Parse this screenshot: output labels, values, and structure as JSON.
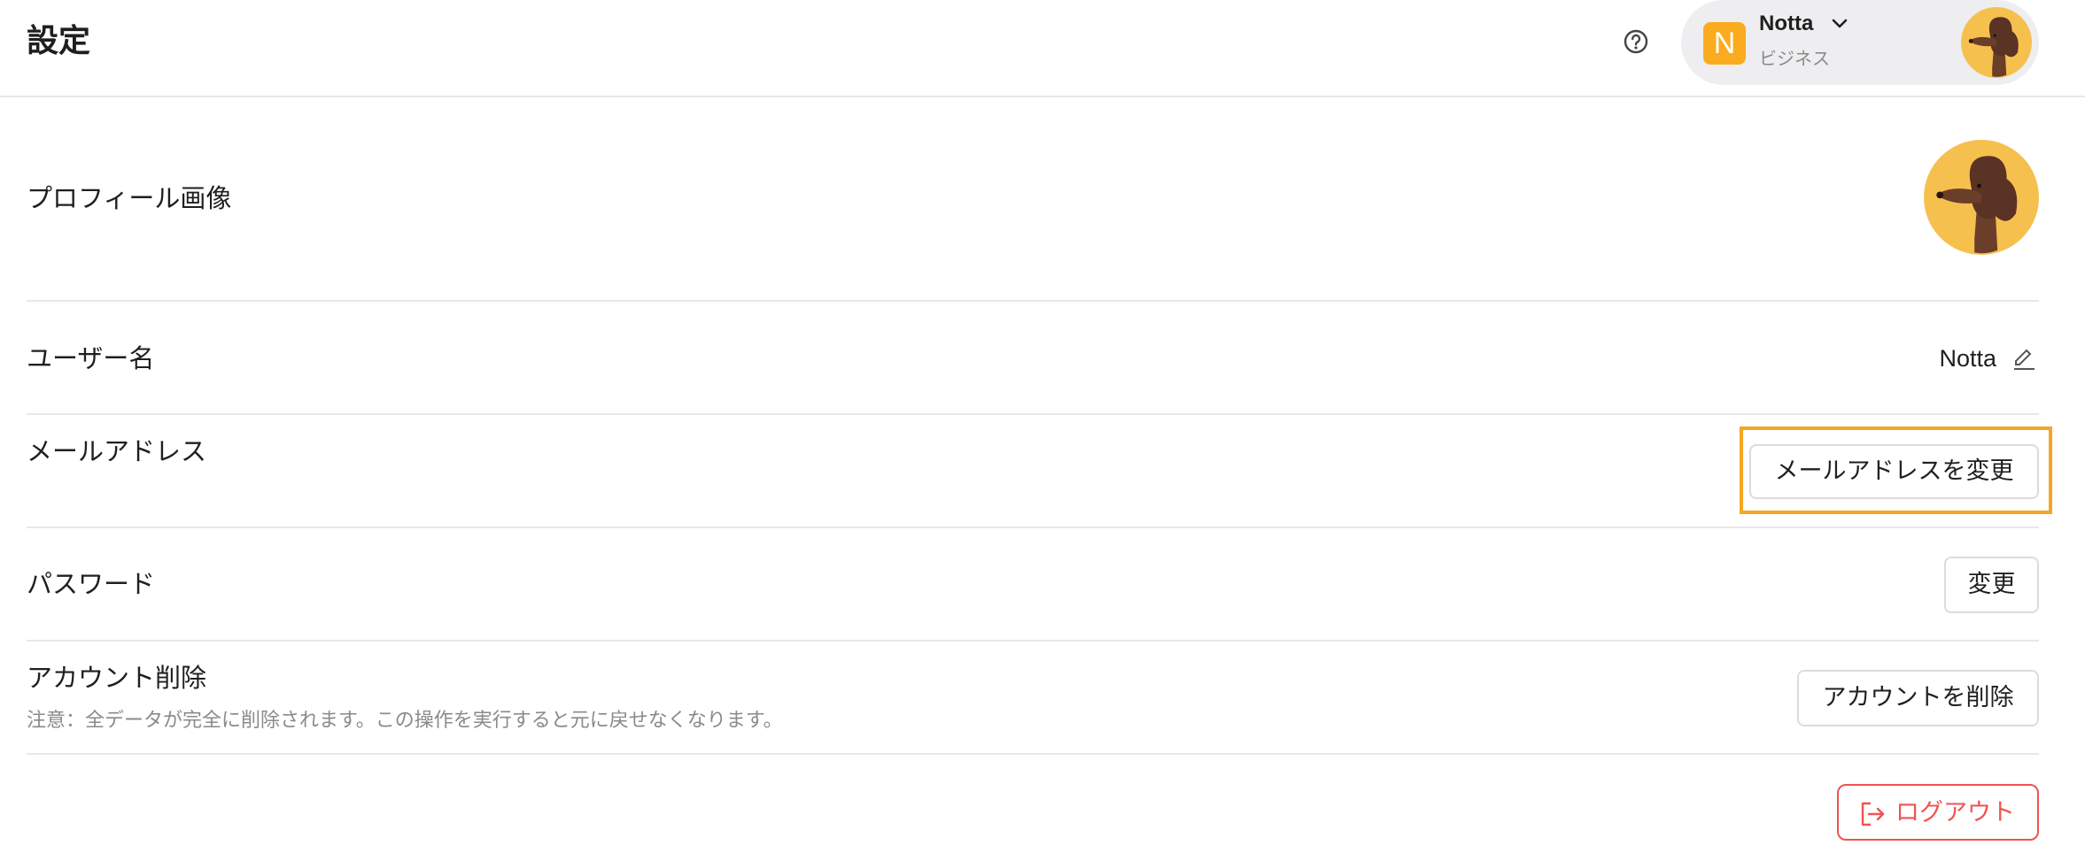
{
  "header": {
    "title": "設定",
    "help_icon": "help-circle-icon",
    "account": {
      "workspace_initial": "N",
      "workspace_name": "Notta",
      "plan": "ビジネス",
      "avatar_icon": "poodle-avatar-icon",
      "dropdown_icon": "chevron-down-icon"
    }
  },
  "settings": {
    "profile_image_label": "プロフィール画像",
    "username_label": "ユーザー名",
    "username_value": "Notta",
    "email_label": "メールアドレス",
    "email_change_button": "メールアドレスを変更",
    "password_label": "パスワード",
    "password_change_button": "変更",
    "delete_account_label": "アカウント削除",
    "delete_account_note": "注意：全データが完全に削除されます。この操作を実行すると元に戻せなくなります。",
    "delete_account_button": "アカウントを削除",
    "logout_button": "ログアウト"
  },
  "colors": {
    "accent_orange": "#f5a623",
    "badge_orange": "#fbab1e",
    "logout_red": "#ef5350",
    "avatar_yellow": "#f6c04f",
    "divider": "#e8e8e8"
  }
}
